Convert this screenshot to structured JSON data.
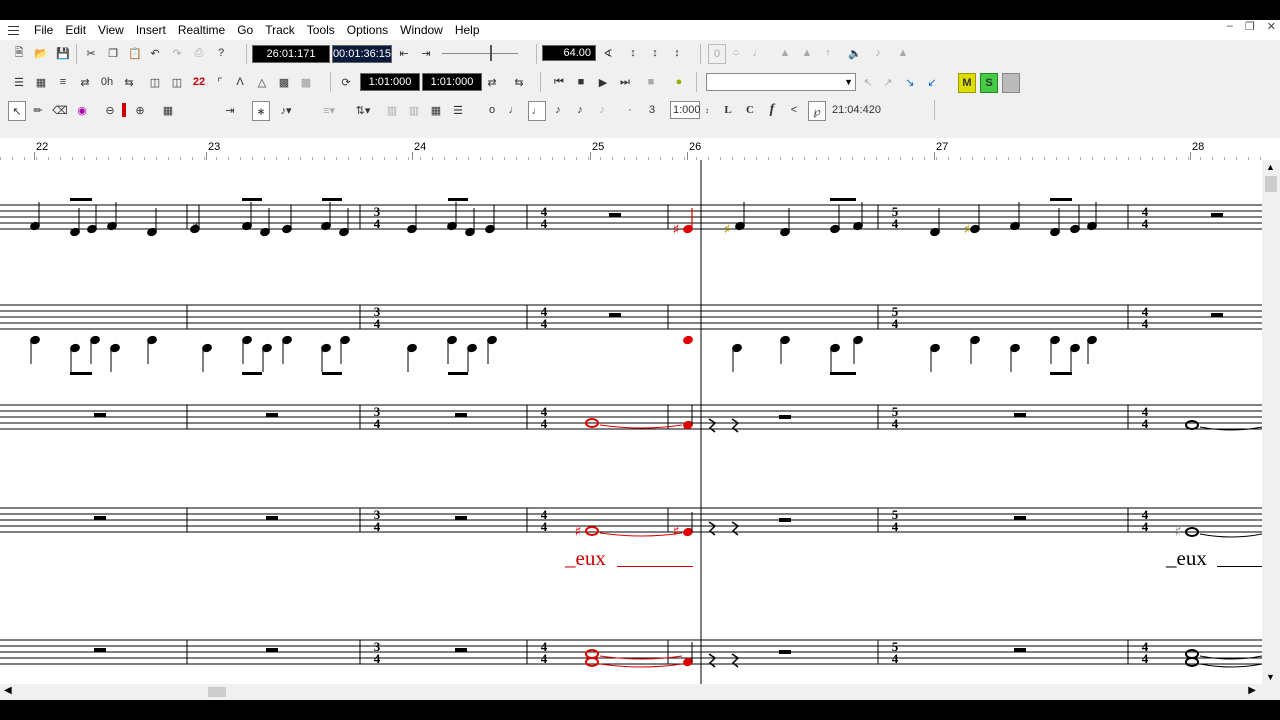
{
  "menu": [
    "File",
    "Edit",
    "View",
    "Insert",
    "Realtime",
    "Go",
    "Track",
    "Tools",
    "Options",
    "Window",
    "Help"
  ],
  "toolbar": {
    "now_time": "26:01:171",
    "smpte": "00:01:36:15",
    "tempo": "64.00",
    "from_time": "1:01:000",
    "thru_time": "1:01:000",
    "duration": "1:000",
    "time_readout": "21:04:420",
    "track_combo": "",
    "m_label": "M",
    "s_label": "S",
    "dur_l": "L",
    "dur_c": "C",
    "dyn_f": "f",
    "small_zero": "0"
  },
  "ruler": {
    "measures": [
      "22",
      "23",
      "24",
      "25",
      "26",
      "27",
      "28"
    ]
  },
  "lyrics": [
    {
      "text": "_eux",
      "color": "#d00000"
    },
    {
      "text": "_eux",
      "color": "#000000"
    }
  ],
  "colors": {
    "selected_note": "#e00000",
    "background": "#ffffff"
  }
}
